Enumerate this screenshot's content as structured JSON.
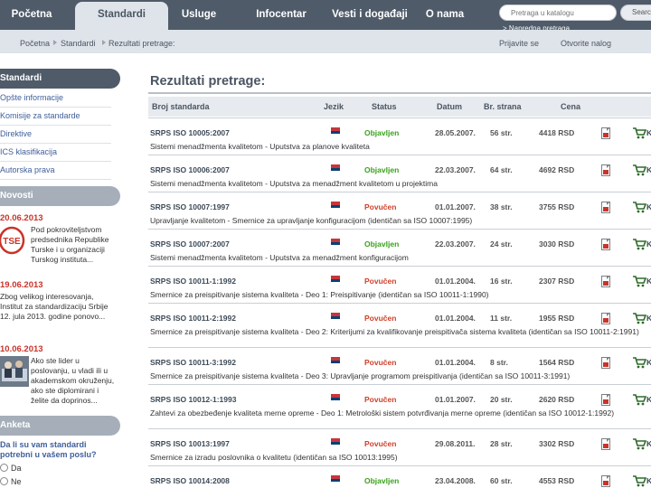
{
  "nav": {
    "items": [
      "Početna",
      "Standardi",
      "Usluge",
      "Infocentar",
      "Vesti i događaji",
      "O nama"
    ],
    "search_placeholder": "Pretraga u katalogu",
    "search_button": "Search",
    "advanced_search": "> Napredna pretraga"
  },
  "breadcrumb": {
    "items": [
      "Početna",
      "Standardi",
      "Rezultati pretrage:"
    ],
    "login": "Prijavite se",
    "open_account": "Otvorite nalog"
  },
  "sidebar": {
    "standards_title": "Standardi",
    "standards_items": [
      "Opšte informacije",
      "Komisije za standarde",
      "Direktive",
      "ICS klasifikacija",
      "Autorska prava"
    ],
    "news_title": "Novosti",
    "news": [
      {
        "date": "20.06.2013",
        "text": "Pod pokroviteljstvom predsednika Republike Turske i u organizaciji Turskog instituta...",
        "logo": "TSE"
      },
      {
        "date": "19.06.2013",
        "text": "Zbog velikog interesovanja, Institut za standardizaciju Srbije 12. jula 2013. godine ponovo..."
      },
      {
        "date": "10.06.2013",
        "text": "Ako ste lider u poslovanju, u vladi ili u akademskom okruženju, ako ste diplomirani i želite da doprinos..."
      }
    ],
    "poll_title": "Anketa",
    "poll_question": "Da li su vam standardi potrebni u vašem poslu?",
    "poll_options": [
      "Da",
      "Ne"
    ]
  },
  "main": {
    "title": "Rezultati pretrage:",
    "columns": [
      "Broj standarda",
      "Jezik",
      "Status",
      "Datum",
      "Br. strana",
      "Cena"
    ],
    "rows": [
      {
        "num": "SRPS ISO 10005:2007",
        "status": "Objavljen",
        "date": "28.05.2007.",
        "pages": "56 str.",
        "price": "4418 RSD",
        "desc": "Sistemi menadžmenta kvalitetom - Uputstva za planove kvaliteta"
      },
      {
        "num": "SRPS ISO 10006:2007",
        "status": "Objavljen",
        "date": "22.03.2007.",
        "pages": "64 str.",
        "price": "4692 RSD",
        "desc": "Sistemi menadžmenta kvalitetom - Uputstva za menadžment kvalitetom u projektima"
      },
      {
        "num": "SRPS ISO 10007:1997",
        "status": "Povučen",
        "date": "01.01.2007.",
        "pages": "38 str.",
        "price": "3755 RSD",
        "desc": "Upravljanje kvalitetom - Smernice za upravljanje konfiguracijom (identičan sa ISO 10007:1995)"
      },
      {
        "num": "SRPS ISO 10007:2007",
        "status": "Objavljen",
        "date": "22.03.2007.",
        "pages": "24 str.",
        "price": "3030 RSD",
        "desc": "Sistemi menadžmenta kvalitetom - Uputstva za menadžment konfiguracijom"
      },
      {
        "num": "SRPS ISO 10011-1:1992",
        "status": "Povučen",
        "date": "01.01.2004.",
        "pages": "16 str.",
        "price": "2307 RSD",
        "desc": "Smernice za preispitivanje sistema kvaliteta - Deo 1: Preispitivanje (identičan sa ISO 10011-1:1990)"
      },
      {
        "num": "SRPS ISO 10011-2:1992",
        "status": "Povučen",
        "date": "01.01.2004.",
        "pages": "11 str.",
        "price": "1955 RSD",
        "desc": "Smernice za preispitivanje sistema kvaliteta - Deo 2: Kriterijumi za kvalifikovanje preispitivača sistema kvaliteta (identičan sa ISO 10011-2:1991)"
      },
      {
        "num": "SRPS ISO 10011-3:1992",
        "status": "Povučen",
        "date": "01.01.2004.",
        "pages": "8 str.",
        "price": "1564 RSD",
        "desc": "Smernice za preispitivanje sistema kvaliteta - Deo 3: Upravljanje programom preispitivanja (identičan sa ISO 10011-3:1991)"
      },
      {
        "num": "SRPS ISO 10012-1:1993",
        "status": "Povučen",
        "date": "01.01.2007.",
        "pages": "20 str.",
        "price": "2620 RSD",
        "desc": "Zahtevi za obezbeđenje kvaliteta merne opreme - Deo 1: Metrološki sistem potvrđivanja merne opreme (identičan sa ISO 10012-1:1992)"
      },
      {
        "num": "SRPS ISO 10013:1997",
        "status": "Povučen",
        "date": "29.08.2011.",
        "pages": "28 str.",
        "price": "3302 RSD",
        "desc": "Smernice za izradu poslovnika o kvalitetu (identičan sa ISO 10013:1995)"
      },
      {
        "num": "SRPS ISO 10014:2008",
        "status": "Objavljen",
        "date": "23.04.2008.",
        "pages": "60 str.",
        "price": "4553 RSD",
        "desc": ""
      }
    ],
    "k_label": "K"
  },
  "colors": {
    "nav_bg": "#4f5b69",
    "status_published": "#3aa11c",
    "status_withdrawn": "#d0402a",
    "date_red": "#c8342a"
  }
}
